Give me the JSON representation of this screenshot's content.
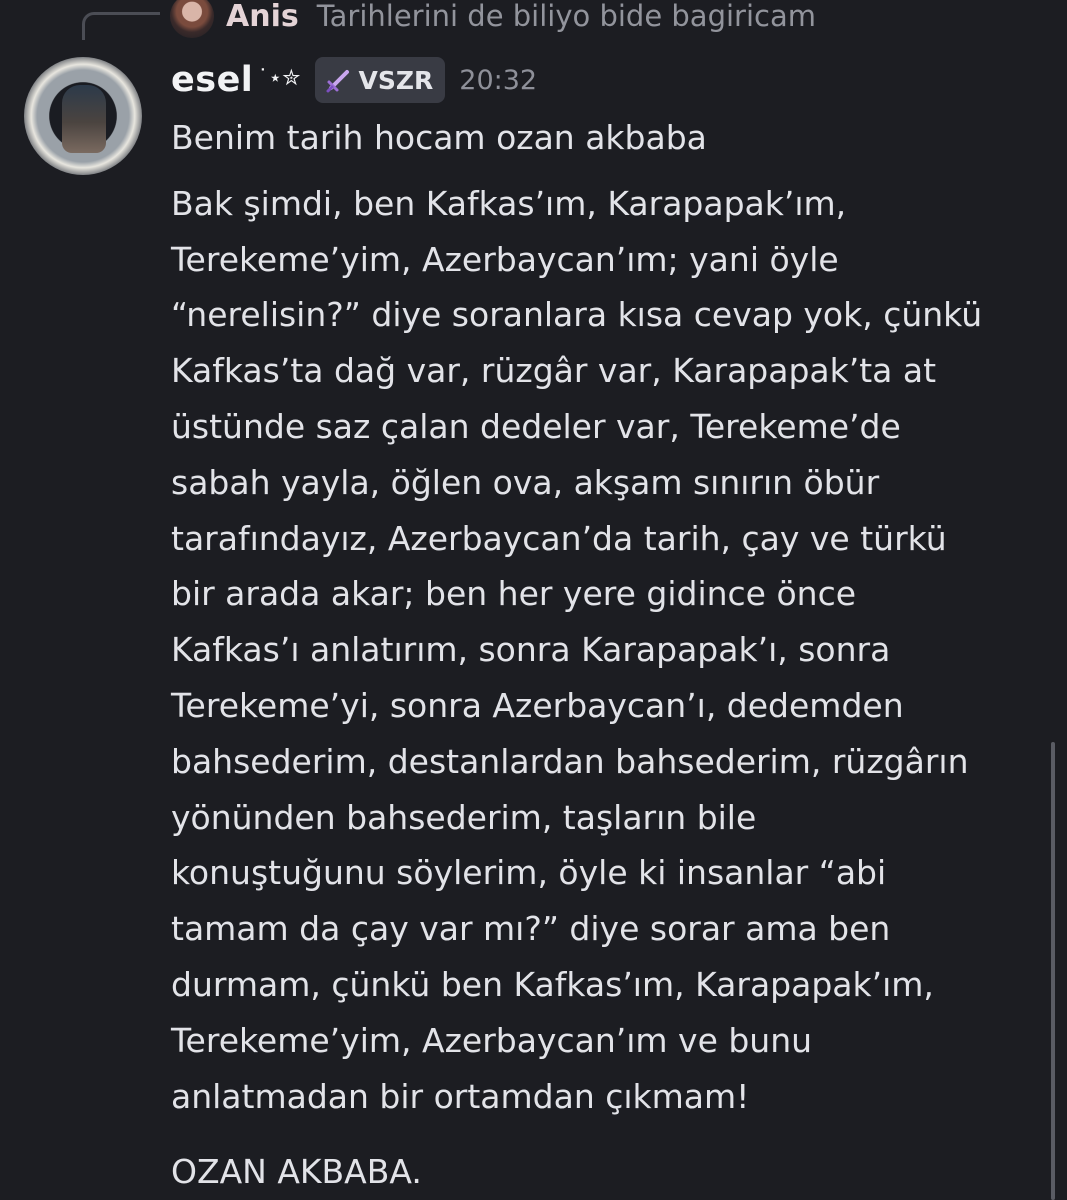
{
  "reply": {
    "author": "Anis",
    "text": "Tarihlerini de biliyo bide bagiricam"
  },
  "message": {
    "username": "esel",
    "username_decoration": "˙⋆✮",
    "tag_label": "VSZR",
    "tag_icon": "sword-icon",
    "timestamp": "20:32",
    "lines": [
      "Benim tarih hocam ozan akbaba",
      "Bak şimdi, ben Kafkas’ım, Karapapak’ım,\nTerekeme’yim, Azerbaycan’ım; yani öyle\n“nerelisin?” diye soranlara kısa cevap yok, çünkü\nKafkas’ta dağ var, rüzgâr var, Karapapak’ta at\nüstünde saz çalan dedeler var, Terekeme’de\nsabah yayla, öğlen ova, akşam sınırın öbür\ntarafındayız, Azerbaycan’da tarih, çay ve türkü\nbir arada akar; ben her yere gidince önce\nKafkas’ı anlatırım, sonra Karapapak’ı, sonra\nTerekeme’yi, sonra Azerbaycan’ı, dedemden\nbahsederim, destanlardan bahsederim, rüzgârın\nyönünden bahsederim, taşların bile\nkonuştuğunu söylerim, öyle ki insanlar “abi\ntamam da çay var mı?” diye sorar ama ben\ndurmam, çünkü ben Kafkas’ım, Karapapak’ım,\nTerekeme’yim, Azerbaycan’ım ve bunu\nanlatmadan bir ortamdan çıkmam!",
      "OZAN AKBABA."
    ]
  },
  "colors": {
    "background": "#1c1d22",
    "tag_background": "#393b44",
    "muted_text": "#92949c"
  }
}
